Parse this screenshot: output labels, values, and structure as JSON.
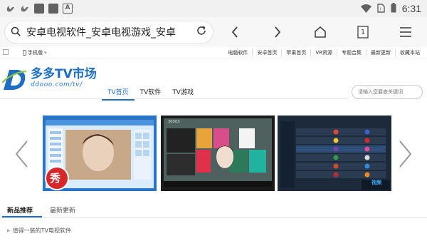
{
  "status_bar": {
    "time": "6:31",
    "app_letter": "A",
    "icons": [
      "uc-icon",
      "uc-icon",
      "app-square-icon",
      "app-square-icon",
      "app-a-icon",
      "wifi-icon",
      "sim-icon",
      "battery-icon"
    ]
  },
  "browser": {
    "url_text": "安卓电视软件_安卓电视游戏_安卓",
    "tab_count": "1"
  },
  "site": {
    "mobile_label": "手机版",
    "top_links": [
      "电脑软件",
      "安卓首页",
      "苹果首页",
      "VR资源",
      "专题合集",
      "最新更新",
      "收藏本站"
    ],
    "logo_title": "多多TV市场",
    "logo_sub": "ddooo.com/tv/",
    "nav": [
      "TV首页",
      "TV软件",
      "TV游戏"
    ],
    "search_placeholder": "请输入您要查关键词",
    "slide_badge": "秀",
    "slide2_brand": "360OS",
    "slide3_brand": "视频",
    "tabs": [
      "新品推荐",
      "最新更新"
    ],
    "subheading": "值得一装的TV电视软件"
  },
  "colors": {
    "accent": "#1e6ec6",
    "statusbar_bg": "#f1f1f1",
    "toolbar_bg": "#f7f7f7"
  }
}
